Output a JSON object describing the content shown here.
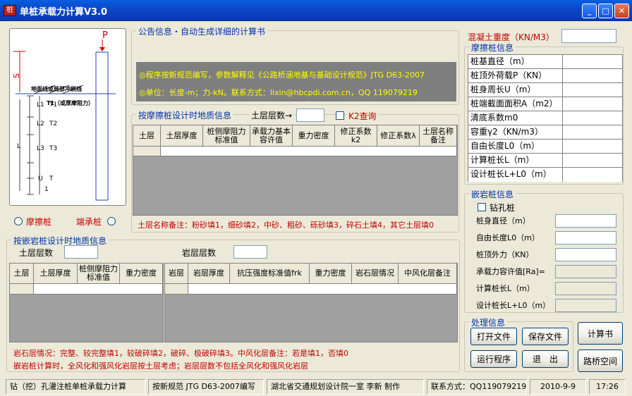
{
  "window": {
    "title": "单桩承载力计算V3.0",
    "icon": "app-icon"
  },
  "diagram": {
    "p_label": "P",
    "s_label": "S",
    "ground_text": "地面线或局部冲刷线",
    "t1_text": "T1（或厚摩阻力）",
    "layer_labels": [
      "L1",
      "L2",
      "L3",
      "U"
    ],
    "t_labels": [
      "T1",
      "T2",
      "T3",
      "T"
    ],
    "l_label": "L",
    "one_label": "1"
  },
  "pile_type": {
    "friction": "摩擦桩",
    "end_bearing": "端承桩"
  },
  "notice": {
    "title": "公告信息・自动生成详细的计算书",
    "line1": "◎程序按新规范编写，参数解释见《公路桥涵地基与基础设计规范》JTG D63-2007",
    "line2": "◎单位：长度-m；力-kN。联系方式：lixin@hbcpdi.com.cn，QQ 119079219"
  },
  "friction_geo": {
    "title": "按摩擦桩设计时地质信息",
    "layers_label": "土层层数→",
    "k2_label": "K2查询",
    "columns": [
      "土层",
      "土层厚度",
      "桩侧摩阻力标准值",
      "承载力基本容许值",
      "重力密度",
      "修正系数k2",
      "修正系数λ",
      "土层名称备注"
    ],
    "note": "土层名称备注：粉砂填1，细砂填2，中砂、粗砂、砾砂填3，碎石土填4，其它土层填0"
  },
  "rock_geo": {
    "title": "按嵌岩桩设计时地质信息",
    "soil_layers_label": "土层层数",
    "rock_layers_label": "岩层层数",
    "soil_columns": [
      "土层",
      "土层厚度",
      "桩侧摩阻力标准值",
      "重力密度"
    ],
    "rock_columns": [
      "岩层",
      "岩层厚度",
      "抗压强度标准值frk",
      "重力密度",
      "岩石层情况",
      "中风化层备注"
    ],
    "note1": "岩石层情况：完整、较完整填1，较破碎填2，破碎、极破碎填3。中风化层备注：若是填1，否填0",
    "note2": "嵌岩桩计算时，全风化和强风化岩层按土层考虑；岩层层数不包括全风化和强风化岩层"
  },
  "concrete": {
    "label": "混凝土重度（KN/M3）"
  },
  "friction_pile": {
    "title": "摩擦桩信息",
    "rows": [
      "桩基直径（m）",
      "桩顶外荷载P（KN）",
      "桩身周长U（m）",
      "桩端截面面积A（m2）",
      "清底系数m0",
      "容重γ2（KN/m3）",
      "自由长度L0（m）",
      "计算桩长L（m）",
      "设计桩长L+L0（m）"
    ]
  },
  "rock_pile": {
    "title": "嵌岩桩信息",
    "bored_label": "钻孔桩",
    "rows": [
      "桩身直径（m）",
      "自由长度L0（m）",
      "桩顶外力（KN）",
      "承载力容许值[Ra]=",
      "计算桩长L（m）",
      "设计桩长L+L0（m）"
    ]
  },
  "processing": {
    "title": "处理信息",
    "open": "打开文件",
    "save": "保存文件",
    "run": "运行程序",
    "exit": "退　出"
  },
  "side_buttons": {
    "report": "计算书",
    "space": "路桥空间"
  },
  "statusbar": {
    "s1": "钻（挖）孔灌注桩单桩承载力计算",
    "s2": "按新规范 JTG D63-2007编写",
    "s3": "湖北省交通规划设计院一室 李新 制作",
    "s4": "联系方式：QQ119079219",
    "s5": "2010-9-9",
    "s6": "17:26"
  },
  "colors": {
    "title_bar": "#0b46c8",
    "notice_bg": "#7f7f7f",
    "notice_text": "#ffff00",
    "accent_red": "#c00000",
    "accent_blue": "#0033aa"
  }
}
